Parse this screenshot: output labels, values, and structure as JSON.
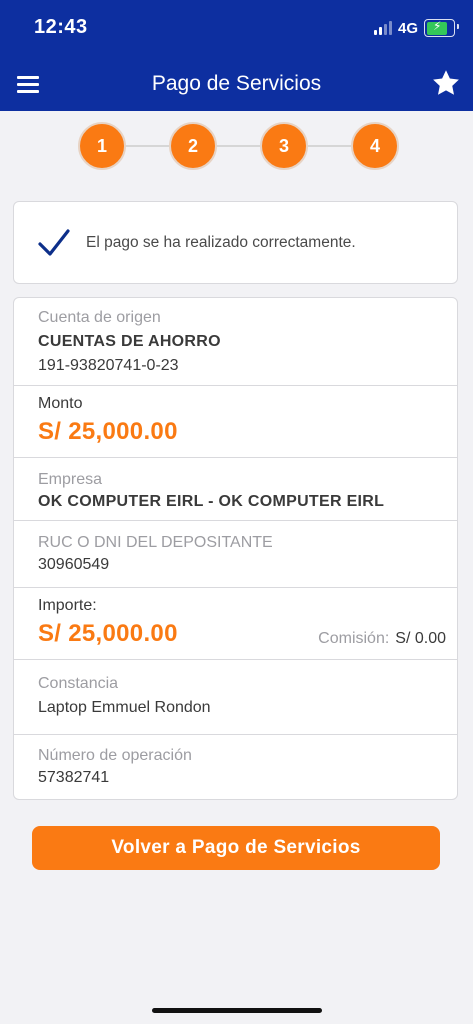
{
  "status_bar": {
    "time": "12:43",
    "network": "4G"
  },
  "header": {
    "title": "Pago de Servicios"
  },
  "stepper": {
    "steps": [
      "1",
      "2",
      "3",
      "4"
    ]
  },
  "success": {
    "message": "El pago se ha realizado correctamente."
  },
  "details": {
    "origin": {
      "label": "Cuenta de origen",
      "account_type": "CUENTAS DE AHORRO",
      "account_number": "191-93820741-0-23"
    },
    "amount": {
      "label": "Monto",
      "value": "S/ 25,000.00"
    },
    "company": {
      "label": "Empresa",
      "value": "OK COMPUTER EIRL - OK COMPUTER EIRL"
    },
    "depositor": {
      "label": "RUC O DNI DEL DEPOSITANTE",
      "value": "30960549"
    },
    "total": {
      "label": "Importe:",
      "value": "S/ 25,000.00",
      "commission_label": "Comisión:",
      "commission_value": "S/ 0.00"
    },
    "receipt": {
      "label": "Constancia",
      "value": "Laptop Emmuel Rondon"
    },
    "operation": {
      "label": "Número de operación",
      "value": "57382741"
    }
  },
  "actions": {
    "back_label": "Volver a Pago de Servicios"
  },
  "colors": {
    "header_bg": "#0d2fa0",
    "accent": "#fa7a13",
    "check": "#0d2f8a",
    "page_bg": "#f2f2f5"
  }
}
